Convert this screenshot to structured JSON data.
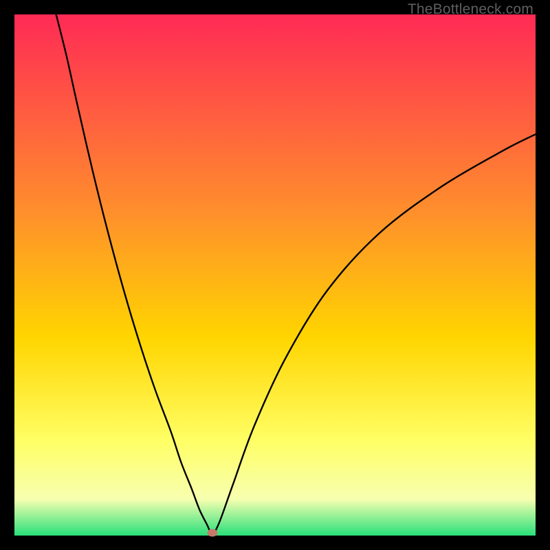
{
  "watermark": {
    "text": "TheBottleneck.com"
  },
  "colors": {
    "top": "#ff2a55",
    "mid_upper": "#ff8f2c",
    "mid": "#ffd500",
    "lower": "#ffff66",
    "near_bottom": "#f7ffb0",
    "bottom": "#28e07a",
    "curve": "#000000",
    "marker": "#c77a6c",
    "frame": "#000000"
  },
  "chart_data": {
    "type": "line",
    "title": "",
    "xlabel": "",
    "ylabel": "",
    "xlim": [
      0,
      100
    ],
    "ylim": [
      0,
      100
    ],
    "notes": "V-shaped bottleneck curve over a vertical rainbow gradient (red at top = high bottleneck, green at bottom = optimal). Minimum highlighted by a small marker near x≈38.",
    "x": [
      8,
      10,
      12,
      15,
      18,
      21,
      24,
      27,
      30,
      32,
      34,
      35.5,
      37,
      37.7,
      38.3,
      39.5,
      42,
      46,
      52,
      60,
      70,
      82,
      94,
      100
    ],
    "y": [
      100,
      92,
      83,
      70,
      58,
      47,
      37,
      28,
      20,
      14,
      9,
      5,
      2,
      0.5,
      0.5,
      3,
      10,
      21,
      34,
      47,
      58,
      67,
      74,
      77
    ],
    "marker": {
      "x": 38,
      "y": 0.5
    },
    "gradient_stops": [
      {
        "offset": 0.0,
        "color": "#ff2a55"
      },
      {
        "offset": 0.38,
        "color": "#ff8f2c"
      },
      {
        "offset": 0.62,
        "color": "#ffd500"
      },
      {
        "offset": 0.82,
        "color": "#ffff66"
      },
      {
        "offset": 0.93,
        "color": "#f7ffb0"
      },
      {
        "offset": 1.0,
        "color": "#28e07a"
      }
    ]
  }
}
